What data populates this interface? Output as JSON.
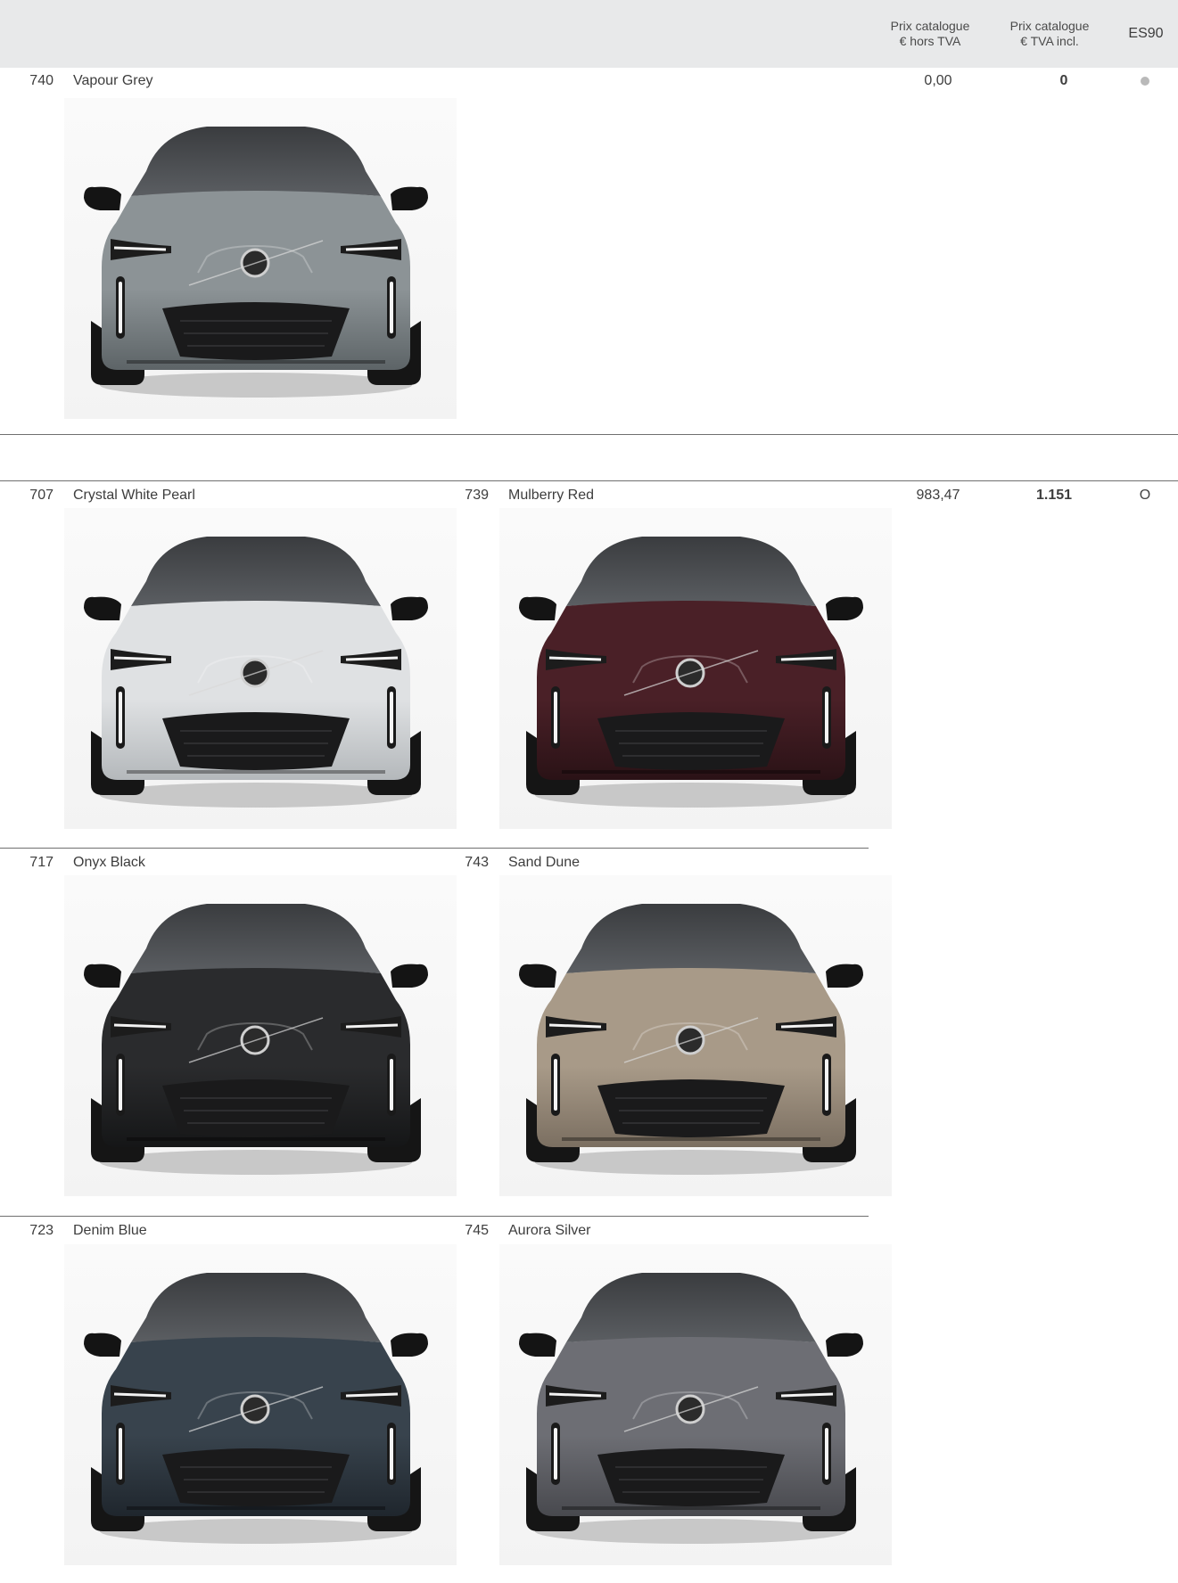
{
  "header": {
    "col_excl_line1": "Prix catalogue",
    "col_excl_line2": "€ hors TVA",
    "col_incl_line1": "Prix catalogue",
    "col_incl_line2": "€ TVA incl.",
    "col_model": "ES90"
  },
  "standard_group": {
    "price_excl": "0,00",
    "price_incl": "0",
    "availability": "standard",
    "colors": [
      {
        "code": "740",
        "name": "Vapour Grey",
        "paint": "#8c9396",
        "paint_dark": "#5d6467"
      }
    ]
  },
  "option_group": {
    "price_excl": "983,47",
    "price_incl": "1.151",
    "availability": "O",
    "colors": [
      {
        "code": "707",
        "name": "Crystal White Pearl",
        "paint": "#dfe1e3",
        "paint_dark": "#b4b8bb"
      },
      {
        "code": "739",
        "name": "Mulberry Red",
        "paint": "#4a2027",
        "paint_dark": "#2a1216"
      },
      {
        "code": "717",
        "name": "Onyx Black",
        "paint": "#2a2b2d",
        "paint_dark": "#151617"
      },
      {
        "code": "743",
        "name": "Sand Dune",
        "paint": "#a89a88",
        "paint_dark": "#7b6f61"
      },
      {
        "code": "723",
        "name": "Denim Blue",
        "paint": "#38434d",
        "paint_dark": "#1f262d"
      },
      {
        "code": "745",
        "name": "Aurora Silver",
        "paint": "#6d6e74",
        "paint_dark": "#48494e"
      }
    ]
  }
}
